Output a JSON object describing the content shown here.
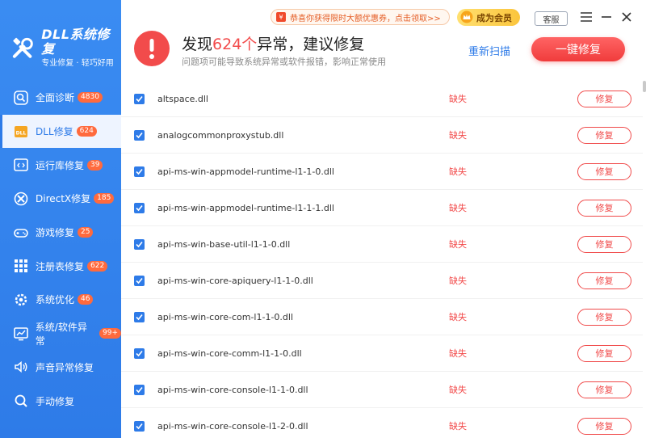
{
  "app": {
    "title": "DLL系统修复",
    "subtitle": "专业修复 · 轻巧好用"
  },
  "sidebar": {
    "items": [
      {
        "label": "全面诊断",
        "badge": "4830",
        "icon": "search-shield-icon"
      },
      {
        "label": "DLL修复",
        "badge": "624",
        "icon": "dll-icon",
        "active": true
      },
      {
        "label": "运行库修复",
        "badge": "39",
        "icon": "code-window-icon"
      },
      {
        "label": "DirectX修复",
        "badge": "185",
        "icon": "directx-icon"
      },
      {
        "label": "游戏修复",
        "badge": "25",
        "icon": "gamepad-icon"
      },
      {
        "label": "注册表修复",
        "badge": "622",
        "icon": "grid-icon"
      },
      {
        "label": "系统优化",
        "badge": "46",
        "icon": "gear-icon"
      },
      {
        "label": "系统/软件异常",
        "badge": "99+",
        "icon": "chart-icon"
      },
      {
        "label": "声音异常修复",
        "badge": "",
        "icon": "speaker-icon"
      },
      {
        "label": "手动修复",
        "badge": "",
        "icon": "magnifier-icon"
      }
    ]
  },
  "topbar": {
    "promo": "恭喜你获得限时大额优惠券，点击领取>>",
    "vip": "成为会员",
    "service": "客服",
    "menu_icon": "menu-icon",
    "minimize_icon": "minimize-icon",
    "close_icon": "close-icon"
  },
  "summary": {
    "headline_prefix": "发现",
    "count": "624个",
    "headline_suffix": "异常，建议修复",
    "subline": "问题项可能导致系统异常或软件报错，影响正常使用",
    "rescan": "重新扫描",
    "fix_all": "一键修复"
  },
  "list": {
    "status_label": "缺失",
    "fix_label": "修复",
    "rows": [
      "altspace.dll",
      "analogcommonproxystub.dll",
      "api-ms-win-appmodel-runtime-l1-1-0.dll",
      "api-ms-win-appmodel-runtime-l1-1-1.dll",
      "api-ms-win-base-util-l1-1-0.dll",
      "api-ms-win-core-apiquery-l1-1-0.dll",
      "api-ms-win-core-com-l1-1-0.dll",
      "api-ms-win-core-comm-l1-1-0.dll",
      "api-ms-win-core-console-l1-1-0.dll",
      "api-ms-win-core-console-l1-2-0.dll"
    ]
  },
  "colors": {
    "sidebar": "#2e7be8",
    "accent": "#2e7be8",
    "danger": "#f24b4b"
  }
}
